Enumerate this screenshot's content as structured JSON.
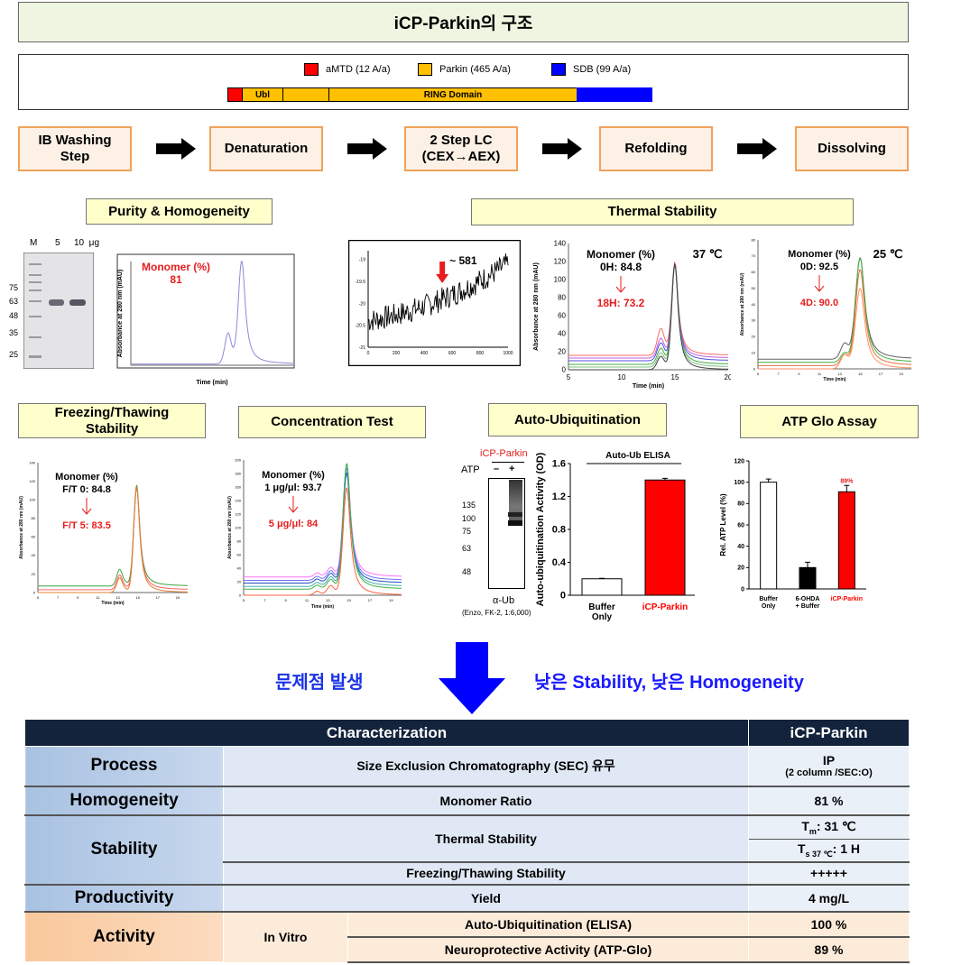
{
  "title": "iCP-Parkin의 구조",
  "domain": {
    "legend": [
      {
        "label": "aMTD (12 A/a)",
        "color": "#ff0000"
      },
      {
        "label": "Parkin (465 A/a)",
        "color": "#ffc000"
      },
      {
        "label": "SDB (99 A/a)",
        "color": "#0000ff"
      }
    ],
    "segments": [
      {
        "label": "",
        "color": "#ff0000"
      },
      {
        "label": "Ubl",
        "color": "#ffc000"
      },
      {
        "label": "",
        "color": "#ffc000"
      },
      {
        "label": "RING  Domain",
        "color": "#ffc000"
      },
      {
        "label": "",
        "color": "#0000ff"
      }
    ]
  },
  "process_steps": [
    "IB Washing\nStep",
    "Denaturation",
    "2 Step LC\n(CEX→AEX)",
    "Refolding",
    "Dissolving"
  ],
  "sections": {
    "purity": "Purity & Homogeneity",
    "thermal": "Thermal Stability",
    "freeze": "Freezing/Thawing Stability",
    "conc": "Concentration Test",
    "autoub": "Auto-Ubiquitination",
    "atp": "ATP Glo Assay"
  },
  "gel": {
    "lanes": [
      "M",
      "5",
      "10  μg"
    ],
    "markers": [
      "75",
      "63",
      "48",
      "35",
      "25"
    ]
  },
  "problem": {
    "left": "문제점 발생",
    "right": "낮은 Stability, 낮은 Homogeneity"
  },
  "chart_data": [
    {
      "id": "sec",
      "type": "line",
      "xlabel": "Time (min)",
      "ylabel": "Absorbance at 280 nm (mAU)",
      "xlim": [
        0,
        12
      ],
      "ylim": [
        0,
        400
      ],
      "annotation": [
        "Monomer (%)",
        "81"
      ],
      "traces": [
        {
          "color": "#8a8ad8",
          "baseline": 5,
          "peaks": [
            [
              7.2,
              120,
              0.25
            ],
            [
              8.2,
              390,
              0.25
            ]
          ]
        }
      ]
    },
    {
      "id": "dsf",
      "type": "line",
      "xlim": [
        0,
        1000
      ],
      "ylim": [
        -21,
        -18.8
      ],
      "xticks": [
        0,
        200,
        400,
        600,
        800,
        1000
      ],
      "yticks": [
        -21,
        -20.5,
        -20,
        -19.5,
        -19
      ],
      "annotation": "~ 581",
      "marker_x": 530,
      "trend": [
        [
          0,
          -20.4
        ],
        [
          1000,
          -19.1
        ]
      ]
    },
    {
      "id": "t37",
      "type": "line",
      "xlabel": "Time (min)",
      "ylabel": "Absorbance at 280 nm (mAU)",
      "xlim": [
        5,
        20
      ],
      "ylim": [
        0,
        140
      ],
      "xticks": [
        5,
        10,
        15,
        20
      ],
      "yticks": [
        0,
        20,
        40,
        60,
        80,
        100,
        120,
        140
      ],
      "temp": "37 ℃",
      "annotation": {
        "title": "Monomer (%)",
        "start": "0H: 84.8",
        "end": "18H: 73.2"
      },
      "traces": [
        {
          "color": "#ff6a6a",
          "baseline": 16,
          "peaks": [
            [
              13.7,
              30,
              0.35
            ],
            [
              15,
              100,
              0.3
            ]
          ]
        },
        {
          "color": "#c060e0",
          "baseline": 13,
          "peaks": [
            [
              13.7,
              22,
              0.35
            ],
            [
              15,
              102,
              0.3
            ]
          ]
        },
        {
          "color": "#5050e0",
          "baseline": 10,
          "peaks": [
            [
              13.7,
              20,
              0.35
            ],
            [
              15,
              104,
              0.3
            ]
          ]
        },
        {
          "color": "#40b040",
          "baseline": 6,
          "peaks": [
            [
              13.7,
              18,
              0.35
            ],
            [
              15,
              108,
              0.3
            ]
          ]
        },
        {
          "color": "#80c080",
          "baseline": 3,
          "peaks": [
            [
              13.7,
              16,
              0.35
            ],
            [
              15,
              112,
              0.3
            ]
          ]
        },
        {
          "color": "#404040",
          "baseline": 0,
          "peaks": [
            [
              13.7,
              15,
              0.35
            ],
            [
              15,
              116,
              0.3
            ]
          ]
        }
      ]
    },
    {
      "id": "t25",
      "type": "line",
      "xlabel": "Time (min)",
      "ylabel": "Absorbance at 280 nm (mAU)",
      "xlim": [
        5,
        20
      ],
      "ylim": [
        0,
        80
      ],
      "xticks": [
        5,
        7,
        9,
        11,
        13,
        15,
        17,
        19
      ],
      "yticks": [
        0,
        10,
        20,
        30,
        40,
        50,
        60,
        70,
        80
      ],
      "temp": "25 ℃",
      "annotation": {
        "title": "Monomer (%)",
        "start": "0D: 92.5",
        "end": "4D: 90.0"
      },
      "traces": [
        {
          "color": "#606060",
          "baseline": 6,
          "peaks": [
            [
              13.5,
              10,
              0.4
            ],
            [
              15,
              62,
              0.45
            ]
          ]
        },
        {
          "color": "#40b040",
          "baseline": 4,
          "peaks": [
            [
              13.5,
              6,
              0.4
            ],
            [
              15,
              64,
              0.45
            ]
          ]
        },
        {
          "color": "#e07040",
          "baseline": 2,
          "peaks": [
            [
              13.5,
              7,
              0.4
            ],
            [
              15,
              59,
              0.45
            ]
          ]
        },
        {
          "color": "#ff9060",
          "baseline": 0,
          "peaks": [
            [
              13.5,
              9,
              0.4
            ],
            [
              15,
              49,
              0.45
            ]
          ]
        }
      ]
    },
    {
      "id": "ft",
      "type": "line",
      "xlabel": "Time (min)",
      "ylabel": "Absorbance at 280 nm (mAU)",
      "xlim": [
        5,
        20
      ],
      "ylim": [
        0,
        140
      ],
      "xticks": [
        5,
        7,
        9,
        11,
        13,
        15,
        17,
        19
      ],
      "yticks": [
        0,
        20,
        40,
        60,
        80,
        100,
        120,
        140
      ],
      "annotation": {
        "title": "Monomer (%)",
        "start": "F/T  0: 84.8",
        "end": "F/T  5: 83.5"
      },
      "traces": [
        {
          "color": "#40a040",
          "baseline": 7,
          "peaks": [
            [
              13.2,
              18,
              0.3
            ],
            [
              14.9,
              108,
              0.3
            ]
          ]
        },
        {
          "color": "#ff6060",
          "baseline": 3,
          "peaks": [
            [
              13.2,
              16,
              0.3
            ],
            [
              14.9,
              110,
              0.3
            ]
          ]
        },
        {
          "color": "#e08030",
          "baseline": 0,
          "peaks": [
            [
              13.2,
              16,
              0.3
            ],
            [
              14.9,
              112,
              0.3
            ]
          ]
        }
      ]
    },
    {
      "id": "conc",
      "type": "line",
      "xlabel": "Time (min)",
      "ylabel": "Absorbance at 280 nm (mAU)",
      "xlim": [
        5,
        20
      ],
      "ylim": [
        0,
        200
      ],
      "xticks": [
        5,
        7,
        9,
        11,
        13,
        15,
        17,
        19
      ],
      "yticks": [
        0,
        20,
        40,
        60,
        80,
        100,
        120,
        140,
        160,
        180,
        200
      ],
      "annotation": {
        "title": "Monomer (%)",
        "start": "1 μg/μl: 93.7",
        "end": "5 μg/μl: 84"
      },
      "traces": [
        {
          "color": "#ff70ff",
          "baseline": 27,
          "peaks": [
            [
              12,
              6,
              0.3
            ],
            [
              13.3,
              14,
              0.35
            ],
            [
              14.8,
              165,
              0.35
            ]
          ]
        },
        {
          "color": "#7070ff",
          "baseline": 22,
          "peaks": [
            [
              12,
              6,
              0.3
            ],
            [
              13.3,
              14,
              0.35
            ],
            [
              14.8,
              165,
              0.35
            ]
          ]
        },
        {
          "color": "#2050c0",
          "baseline": 18,
          "peaks": [
            [
              12,
              6,
              0.3
            ],
            [
              13.3,
              14,
              0.35
            ],
            [
              14.8,
              162,
              0.35
            ]
          ]
        },
        {
          "color": "#40b0b0",
          "baseline": 13,
          "peaks": [
            [
              12,
              6,
              0.3
            ],
            [
              13.3,
              14,
              0.35
            ],
            [
              14.8,
              180,
              0.35
            ]
          ]
        },
        {
          "color": "#40b040",
          "baseline": 9,
          "peaks": [
            [
              12,
              6,
              0.3
            ],
            [
              13.3,
              14,
              0.35
            ],
            [
              14.8,
              185,
              0.35
            ]
          ]
        },
        {
          "color": "#ff6040",
          "baseline": 0,
          "peaks": [
            [
              12,
              6,
              0.3
            ],
            [
              13.3,
              14,
              0.35
            ],
            [
              14.8,
              158,
              0.35
            ]
          ]
        }
      ]
    },
    {
      "id": "elisa",
      "type": "bar",
      "title": "Auto-Ub ELISA",
      "ylabel": "Auto-ubiquitination Activity (OD)",
      "categories": [
        "Buffer Only",
        "iCP-Parkin"
      ],
      "values": [
        0.2,
        1.4
      ],
      "errors": [
        0.005,
        0.02
      ],
      "colors": [
        "#ffffff",
        "#ff0000"
      ],
      "ylim": [
        0,
        1.6
      ],
      "yticks": [
        "0",
        "0.4",
        "0.8",
        "1.2",
        "1.6"
      ]
    },
    {
      "id": "atp",
      "type": "bar",
      "ylabel": "Rel. ATP Level (%)",
      "categories": [
        "Buffer Only",
        "6-OHDA + Buffer",
        "iCP-Parkin"
      ],
      "values": [
        100,
        20,
        91
      ],
      "errors": [
        3,
        5,
        6
      ],
      "colors": [
        "#ffffff",
        "#000000",
        "#ff0000"
      ],
      "label_colors": [
        "#000000",
        "#000000",
        "#ff0000"
      ],
      "ylim": [
        0,
        120
      ],
      "yticks": [
        "0",
        "20",
        "40",
        "60",
        "80",
        "100",
        "120"
      ],
      "annotation": "89%"
    }
  ],
  "western": {
    "header": "iCP-Parkin",
    "atp_label": "ATP",
    "lanes": [
      "–",
      "+"
    ],
    "markers": [
      "135",
      "100",
      "75",
      "63",
      "48"
    ],
    "antibody": "α-Ub",
    "note": "(Enzo, FK-2, 1:6,000)"
  },
  "table": {
    "header": [
      "Characterization",
      "iCP-Parkin"
    ],
    "process": {
      "label": "Process",
      "item": "Size Exclusion Chromatography (SEC) 유무",
      "value": "IP",
      "value_sub": "(2 column /SEC:O)"
    },
    "homogeneity": {
      "label": "Homogeneity",
      "item": "Monomer Ratio",
      "value": "81 %"
    },
    "stability": {
      "label": "Stability",
      "thermal": "Thermal  Stability",
      "tm_label": "T",
      "tm_sub": "m",
      "tm_value": ": 31 ℃",
      "ts_label": "T",
      "ts_sub": "s 37 ℃",
      "ts_value": ": 1 H",
      "freeze": "Freezing/Thawing Stability",
      "freeze_value": "+++++"
    },
    "productivity": {
      "label": "Productivity",
      "item": "Yield",
      "value": "4 mg/L"
    },
    "activity": {
      "label": "Activity",
      "sub": "In Vitro",
      "items": [
        {
          "name": "Auto-Ubiquitination (ELISA)",
          "value": "100 %"
        },
        {
          "name": "Neuroprotective Activity  (ATP-Glo)",
          "value": "89 %"
        }
      ]
    }
  }
}
